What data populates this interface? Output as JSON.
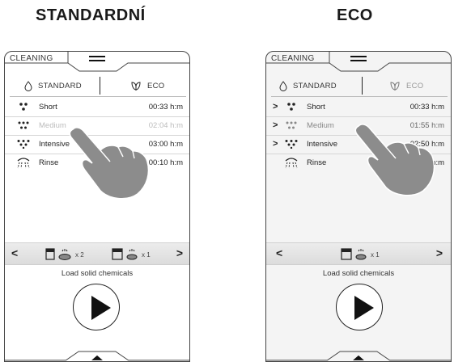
{
  "headings": {
    "left": "STANDARDNÍ",
    "right": "ECO"
  },
  "screens": [
    {
      "title": "CLEANING",
      "tabs": {
        "standard": "STANDARD",
        "eco": "ECO"
      },
      "programs": [
        {
          "name": "Short",
          "time": "00:33 h:m"
        },
        {
          "name": "Medium",
          "time": "02:04 h:m"
        },
        {
          "name": "Intensive",
          "time": "03:00 h:m"
        },
        {
          "name": "Rinse",
          "time": "00:10 h:m"
        }
      ],
      "chemicals": [
        {
          "qty": "x 2"
        },
        {
          "qty": "x 1"
        }
      ],
      "nav": {
        "prev": "<",
        "next": ">"
      },
      "load_label": "Load solid chemicals"
    },
    {
      "title": "CLEANING",
      "tabs": {
        "standard": "STANDARD",
        "eco": "ECO"
      },
      "programs": [
        {
          "name": "Short",
          "time": "00:33 h:m"
        },
        {
          "name": "Medium",
          "time": "01:55 h:m"
        },
        {
          "name": "Intensive",
          "time": "02:50 h:m"
        },
        {
          "name": "Rinse",
          "time": "00:10 h:m"
        }
      ],
      "chevrons": [
        ">",
        ">",
        ">"
      ],
      "chemicals": [
        {
          "qty": "x 1"
        }
      ],
      "nav": {
        "prev": "<",
        "next": ">"
      },
      "load_label": "Load solid chemicals"
    }
  ],
  "icons": {
    "menu": "hamburger-menu-icon",
    "standard": "water-drop-icon",
    "eco": "leaf-icon",
    "short": "drops-3-icon",
    "medium": "drops-6-icon",
    "intensive": "drops-9-icon",
    "rinse": "shower-icon",
    "chemical": "dishwasher-chemical-icon",
    "play": "play-icon",
    "hand": "pointing-hand-icon"
  },
  "colors": {
    "hand": "#8c8c8c",
    "frame": "#444444",
    "dim_text": "#bcbcbc"
  }
}
